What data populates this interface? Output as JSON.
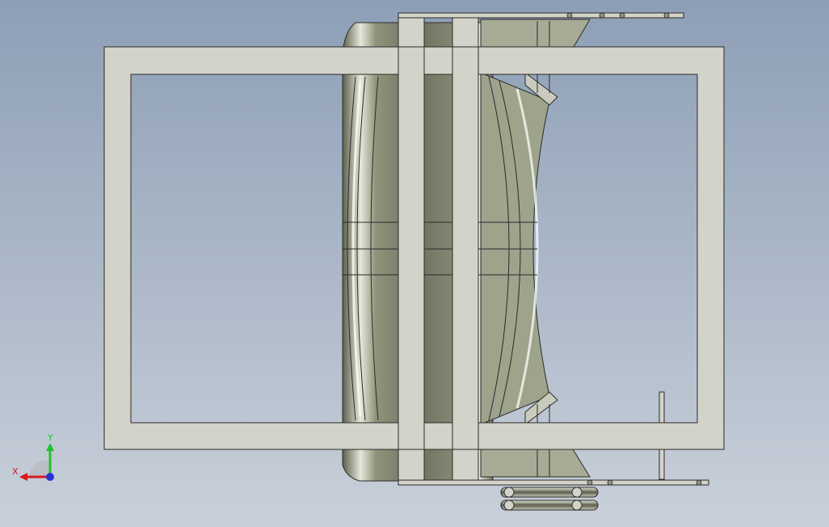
{
  "viewport": {
    "background_top": "#8d9fb6",
    "background_bottom": "#c9d0da"
  },
  "model": {
    "frame_color": "#d4d3c9",
    "frame_stroke": "#2a2a2a",
    "metal_dark": "#5c5f4c",
    "metal_mid": "#8f947b",
    "metal_light": "#e6e8dc",
    "highlight": "#f8f9f2"
  },
  "triad": {
    "x_label": "X",
    "y_label": "Y",
    "x_color": "#d91a1a",
    "y_color": "#22c22a",
    "z_color": "#2a2fd6",
    "sphere_color": "#b9bdc4"
  }
}
